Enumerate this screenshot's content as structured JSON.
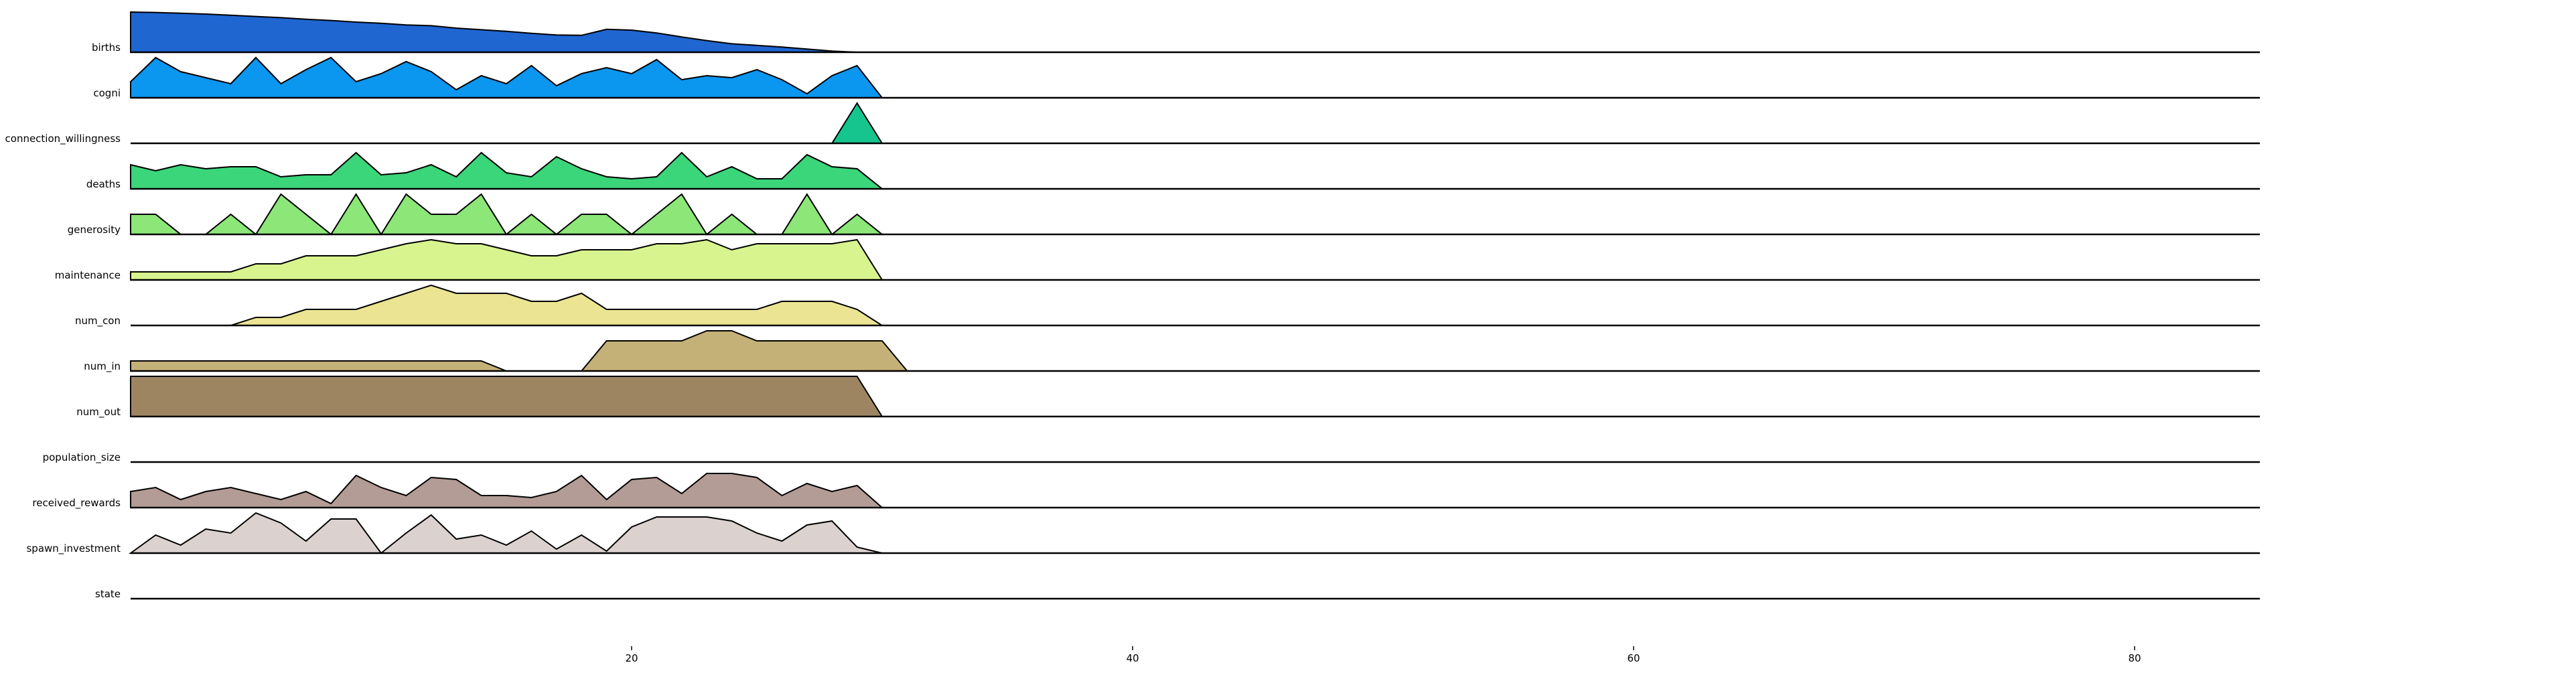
{
  "chart_data": {
    "type": "area",
    "title": "",
    "xlabel": "",
    "ylabel": "",
    "xlim": [
      0,
      85
    ],
    "x_ticks": [
      20,
      40,
      60,
      80
    ],
    "grid": false,
    "legend": "none",
    "series": [
      {
        "name": "births",
        "color": "#1f66d1",
        "x_start": 0,
        "values": [
          1.0,
          0.99,
          0.97,
          0.95,
          0.92,
          0.89,
          0.86,
          0.82,
          0.79,
          0.75,
          0.72,
          0.68,
          0.66,
          0.6,
          0.56,
          0.52,
          0.47,
          0.43,
          0.42,
          0.57,
          0.55,
          0.48,
          0.38,
          0.29,
          0.21,
          0.17,
          0.13,
          0.08,
          0.03,
          0.0
        ]
      },
      {
        "name": "cogni",
        "color": "#0b96f0",
        "x_start": 0,
        "values": [
          0.4,
          1.0,
          0.65,
          0.5,
          0.35,
          1.0,
          0.35,
          0.7,
          1.0,
          0.4,
          0.6,
          0.9,
          0.65,
          0.2,
          0.55,
          0.35,
          0.8,
          0.3,
          0.6,
          0.75,
          0.6,
          0.95,
          0.45,
          0.55,
          0.5,
          0.7,
          0.45,
          0.1,
          0.55,
          0.8,
          0.0
        ]
      },
      {
        "name": "connection_willingness",
        "color": "#16c48d",
        "x_start": 28,
        "values": [
          0.0,
          1.0,
          0.0
        ]
      },
      {
        "name": "deaths",
        "color": "#3bd57a",
        "x_start": 0,
        "values": [
          0.6,
          0.45,
          0.6,
          0.5,
          0.55,
          0.55,
          0.3,
          0.35,
          0.35,
          0.9,
          0.35,
          0.4,
          0.6,
          0.3,
          0.9,
          0.4,
          0.3,
          0.8,
          0.5,
          0.3,
          0.25,
          0.3,
          0.9,
          0.3,
          0.55,
          0.25,
          0.25,
          0.85,
          0.55,
          0.5,
          0.0
        ]
      },
      {
        "name": "generosity",
        "color": "#8ce678",
        "x_start": 0,
        "values": [
          0.5,
          0.5,
          0.0,
          0.0,
          0.5,
          0.0,
          1.0,
          0.5,
          0.0,
          1.0,
          0.0,
          1.0,
          0.5,
          0.5,
          1.0,
          0.0,
          0.5,
          0.0,
          0.5,
          0.5,
          0.0,
          0.5,
          1.0,
          0.0,
          0.5,
          0.0,
          0.0,
          1.0,
          0.0,
          0.5,
          0.0
        ]
      },
      {
        "name": "maintenance",
        "color": "#d8f48f",
        "x_start": 0,
        "values": [
          0.2,
          0.2,
          0.2,
          0.2,
          0.2,
          0.4,
          0.4,
          0.6,
          0.6,
          0.6,
          0.75,
          0.9,
          1.0,
          0.9,
          0.9,
          0.75,
          0.6,
          0.6,
          0.75,
          0.75,
          0.75,
          0.9,
          0.9,
          1.0,
          0.75,
          0.9,
          0.9,
          0.9,
          0.9,
          1.0,
          0.0
        ]
      },
      {
        "name": "num_con",
        "color": "#ebe593",
        "x_start": 0,
        "values": [
          0.0,
          0.0,
          0.0,
          0.0,
          0.0,
          0.2,
          0.2,
          0.4,
          0.4,
          0.4,
          0.6,
          0.8,
          1.0,
          0.8,
          0.8,
          0.8,
          0.6,
          0.6,
          0.8,
          0.4,
          0.4,
          0.4,
          0.4,
          0.4,
          0.4,
          0.4,
          0.6,
          0.6,
          0.6,
          0.4,
          0.0
        ]
      },
      {
        "name": "num_in",
        "color": "#c4b177",
        "x_start": 0,
        "values": [
          0.25,
          0.25,
          0.25,
          0.25,
          0.25,
          0.25,
          0.25,
          0.25,
          0.25,
          0.25,
          0.25,
          0.25,
          0.25,
          0.25,
          0.25,
          0.0,
          0.0,
          0.0,
          0.0,
          0.75,
          0.75,
          0.75,
          0.75,
          1.0,
          1.0,
          0.75,
          0.75,
          0.75,
          0.75,
          0.75,
          0.75,
          0.0
        ]
      },
      {
        "name": "num_out",
        "color": "#9e8562",
        "x_start": 0,
        "values": [
          1.0,
          1.0,
          1.0,
          1.0,
          1.0,
          1.0,
          1.0,
          1.0,
          1.0,
          1.0,
          1.0,
          1.0,
          1.0,
          1.0,
          1.0,
          1.0,
          1.0,
          1.0,
          1.0,
          1.0,
          1.0,
          1.0,
          1.0,
          1.0,
          1.0,
          1.0,
          1.0,
          1.0,
          1.0,
          1.0,
          0.0
        ]
      },
      {
        "name": "population_size",
        "color": "#a78f84",
        "x_start": 0,
        "values": [
          0.0
        ]
      },
      {
        "name": "received_rewards",
        "color": "#b39c95",
        "x_start": 0,
        "values": [
          0.4,
          0.5,
          0.2,
          0.4,
          0.5,
          0.35,
          0.2,
          0.4,
          0.1,
          0.8,
          0.5,
          0.3,
          0.75,
          0.7,
          0.3,
          0.3,
          0.25,
          0.4,
          0.8,
          0.2,
          0.7,
          0.75,
          0.35,
          0.85,
          0.85,
          0.75,
          0.3,
          0.6,
          0.4,
          0.55,
          0.0
        ]
      },
      {
        "name": "spawn_investment",
        "color": "#dbd2cf",
        "x_start": 0,
        "values": [
          0.0,
          0.45,
          0.2,
          0.6,
          0.5,
          1.0,
          0.75,
          0.3,
          0.85,
          0.85,
          0.0,
          0.5,
          0.95,
          0.35,
          0.45,
          0.2,
          0.55,
          0.1,
          0.45,
          0.05,
          0.65,
          0.9,
          0.9,
          0.9,
          0.8,
          0.5,
          0.3,
          0.7,
          0.8,
          0.15,
          0.0
        ]
      },
      {
        "name": "state",
        "color": "#ffffff",
        "x_start": 0,
        "values": [
          0.0
        ]
      }
    ]
  }
}
